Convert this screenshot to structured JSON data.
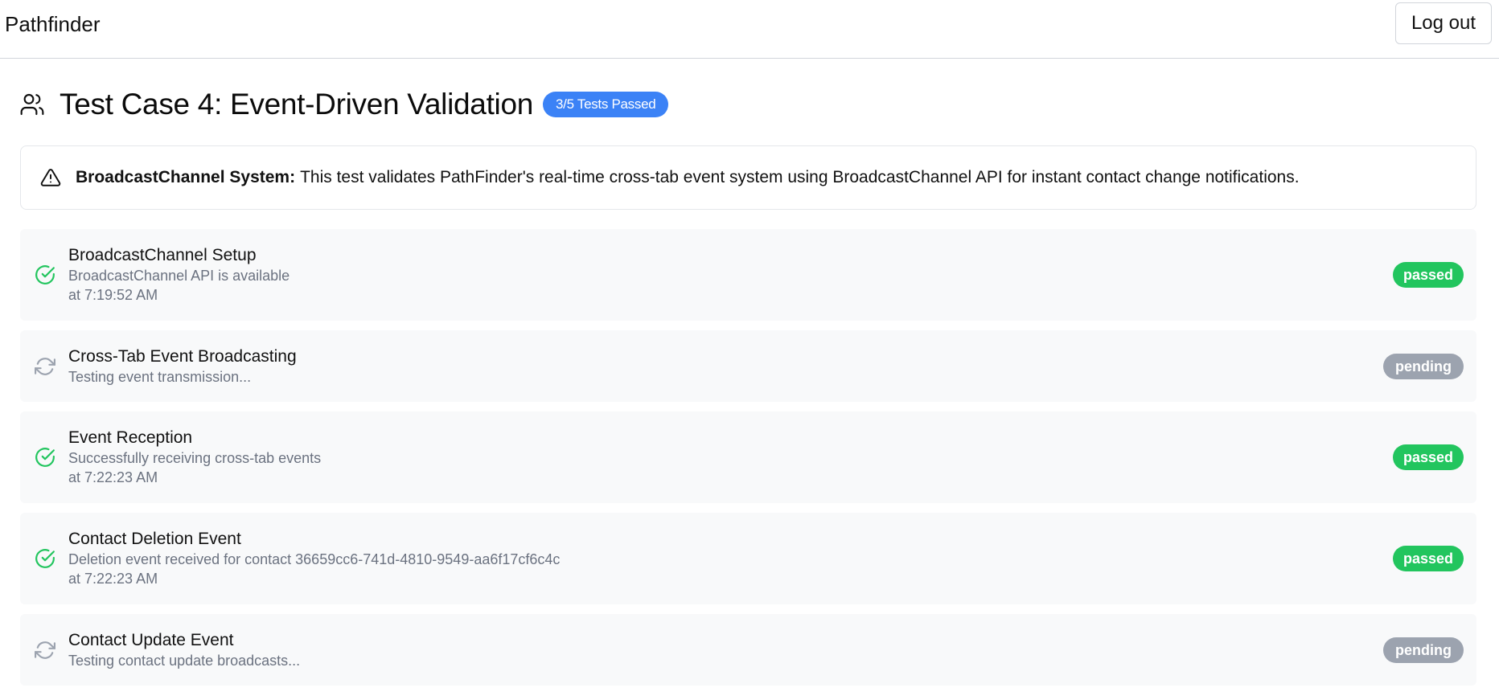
{
  "header": {
    "brand": "Pathfinder",
    "logout_label": "Log out"
  },
  "page": {
    "title": "Test Case 4: Event-Driven Validation",
    "title_icon": "users-icon",
    "summary_badge": "3/5 Tests Passed"
  },
  "alert": {
    "icon": "warning-triangle-icon",
    "title": "BroadcastChannel System:",
    "message": "This test validates PathFinder's real-time cross-tab event system using BroadcastChannel API for instant contact change notifications."
  },
  "tests": [
    {
      "name": "BroadcastChannel Setup",
      "detail": "BroadcastChannel API is available",
      "time": "at 7:19:52 AM",
      "status": "passed",
      "icon": "check-circle-icon"
    },
    {
      "name": "Cross-Tab Event Broadcasting",
      "detail": "Testing event transmission...",
      "time": "",
      "status": "pending",
      "icon": "refresh-icon"
    },
    {
      "name": "Event Reception",
      "detail": "Successfully receiving cross-tab events",
      "time": "at 7:22:23 AM",
      "status": "passed",
      "icon": "check-circle-icon"
    },
    {
      "name": "Contact Deletion Event",
      "detail": "Deletion event received for contact 36659cc6-741d-4810-9549-aa6f17cf6c4c",
      "time": "at 7:22:23 AM",
      "status": "passed",
      "icon": "check-circle-icon"
    },
    {
      "name": "Contact Update Event",
      "detail": "Testing contact update broadcasts...",
      "time": "",
      "status": "pending",
      "icon": "refresh-icon"
    }
  ],
  "colors": {
    "passed": "#22c55e",
    "pending": "#9ca3af",
    "accent": "#3b82f6"
  }
}
